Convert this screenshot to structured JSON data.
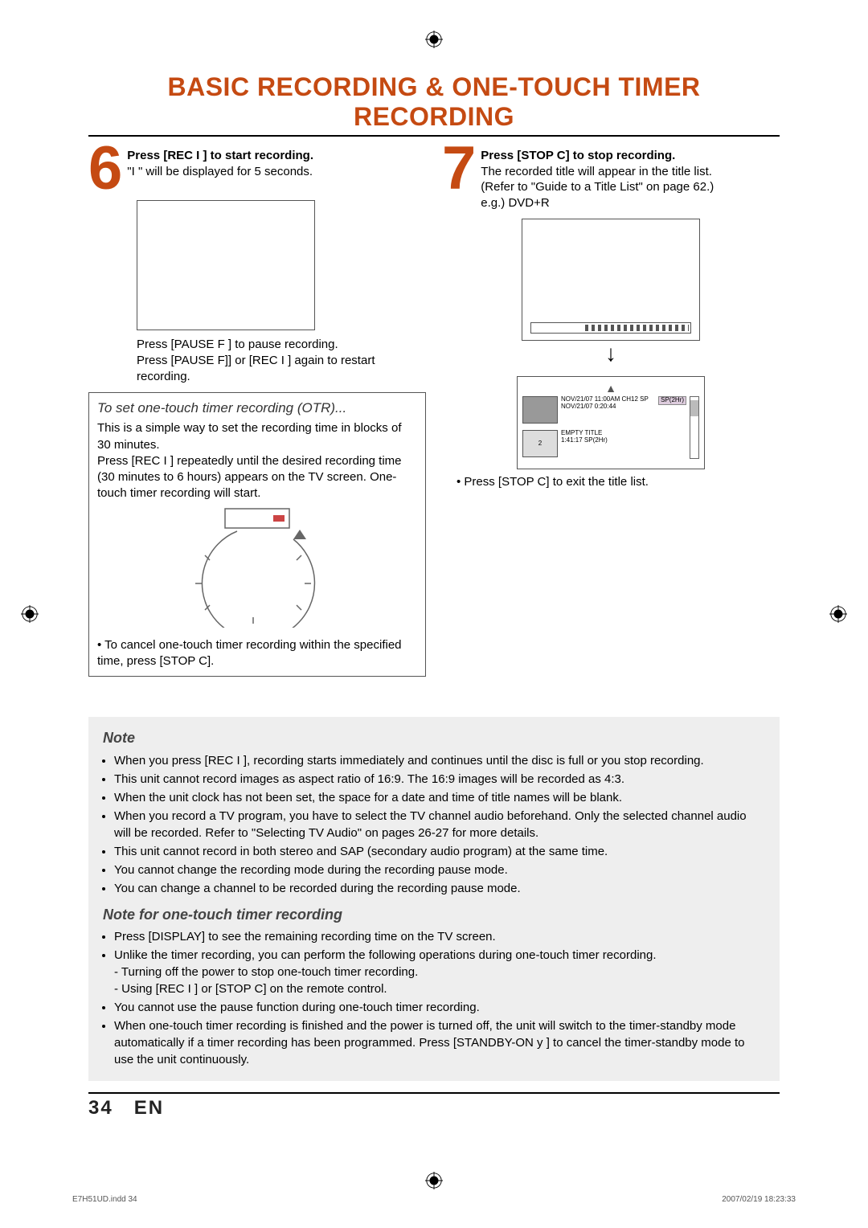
{
  "title": "BASIC RECORDING & ONE-TOUCH TIMER RECORDING",
  "step6": {
    "lead": "Press [REC I ] to start recording.",
    "body": "\"I \" will be displayed for 5 seconds.",
    "pause1": "Press [PAUSE F ] to pause recording.",
    "pause2": "Press [PAUSE F]] or [REC I ] again to restart recording."
  },
  "otr": {
    "title": "To set one-touch timer recording (OTR)...",
    "p1": "This is a simple way to set the recording time in blocks of 30 minutes.",
    "p2": "Press [REC I ] repeatedly until the desired recording time (30 minutes to 6 hours) appears on the TV screen. One-touch timer recording will start.",
    "cancel": "• To cancel one-touch timer recording within the specified time, press [STOP C]."
  },
  "step7": {
    "lead": "Press [STOP C] to stop recording.",
    "body1": "The recorded title will appear in the title list.",
    "body2": "(Refer to \"Guide to a Title List\" on page 62.)",
    "body3": "e.g.) DVD+R",
    "exit": "• Press [STOP C] to exit the title list."
  },
  "title_list": {
    "badge": "SP(2Hr)",
    "row1_line1": "NOV/21/07  11:00AM CH12  SP",
    "row1_line2": "NOV/21/07   0:20:44",
    "row2_num": "2",
    "row2_line1": "EMPTY TITLE",
    "row2_line2": "1:41:17 SP(2Hr)"
  },
  "note": {
    "heading": "Note",
    "items": [
      "When you press [REC I ], recording starts immediately and continues until the disc is full or you stop recording.",
      "This unit cannot record images as aspect ratio of 16:9. The 16:9 images will be recorded as 4:3.",
      "When the unit clock has not been set, the space for a date and time of title names will be blank.",
      "When you record a TV program, you have to select the TV channel audio beforehand. Only the selected channel audio will be recorded. Refer to \"Selecting TV Audio\" on pages 26-27 for more details.",
      "This unit cannot record in both stereo and SAP (secondary audio program) at the same time.",
      "You cannot change the recording mode during the recording pause mode.",
      "You can change a channel to be recorded during the recording pause mode."
    ]
  },
  "note_otr": {
    "heading": "Note for one-touch timer recording",
    "items": [
      "Press [DISPLAY] to see the remaining recording time on the TV screen.",
      "Unlike the timer recording, you can perform the following operations during one-touch timer recording.\n - Turning off the power to stop one-touch timer recording.\n - Using [REC I ] or [STOP C] on the remote control.",
      "You cannot use the pause function during one-touch timer recording.",
      "When one-touch timer recording is finished and the power is turned off, the unit will switch to the timer-standby mode automatically if a timer recording has been programmed. Press [STANDBY-ON y ] to cancel the timer-standby mode to use the unit continuously."
    ]
  },
  "footer": {
    "page": "34",
    "lang": "EN"
  },
  "print": {
    "left": "E7H51UD.indd   34",
    "right": "2007/02/19   18:23:33"
  }
}
